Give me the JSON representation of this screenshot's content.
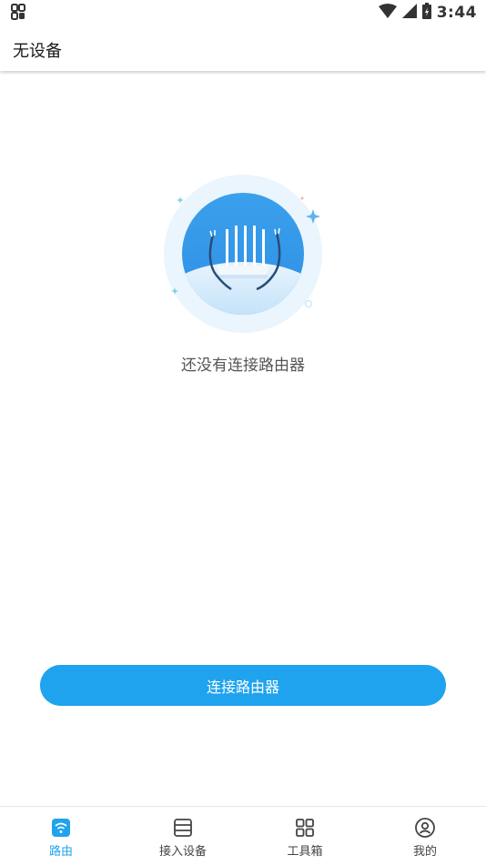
{
  "status_bar": {
    "time": "3:44",
    "left_icon": "sim-card-icon",
    "right_icons": [
      "wifi-icon",
      "signal-icon",
      "battery-icon"
    ]
  },
  "app_bar": {
    "title": "无设备"
  },
  "empty_state": {
    "illustration": "router-illustration",
    "message": "还没有连接路由器"
  },
  "connect_button": {
    "label": "连接路由器"
  },
  "bottom_nav": {
    "items": [
      {
        "label": "路由",
        "icon": "router-wifi-icon",
        "active": true
      },
      {
        "label": "接入设备",
        "icon": "device-list-icon",
        "active": false
      },
      {
        "label": "工具箱",
        "icon": "grid-icon",
        "active": false
      },
      {
        "label": "我的",
        "icon": "profile-icon",
        "active": false
      }
    ]
  },
  "colors": {
    "accent": "#1fa3ee",
    "text_primary": "#1a1a1a",
    "text_secondary": "#555555"
  }
}
